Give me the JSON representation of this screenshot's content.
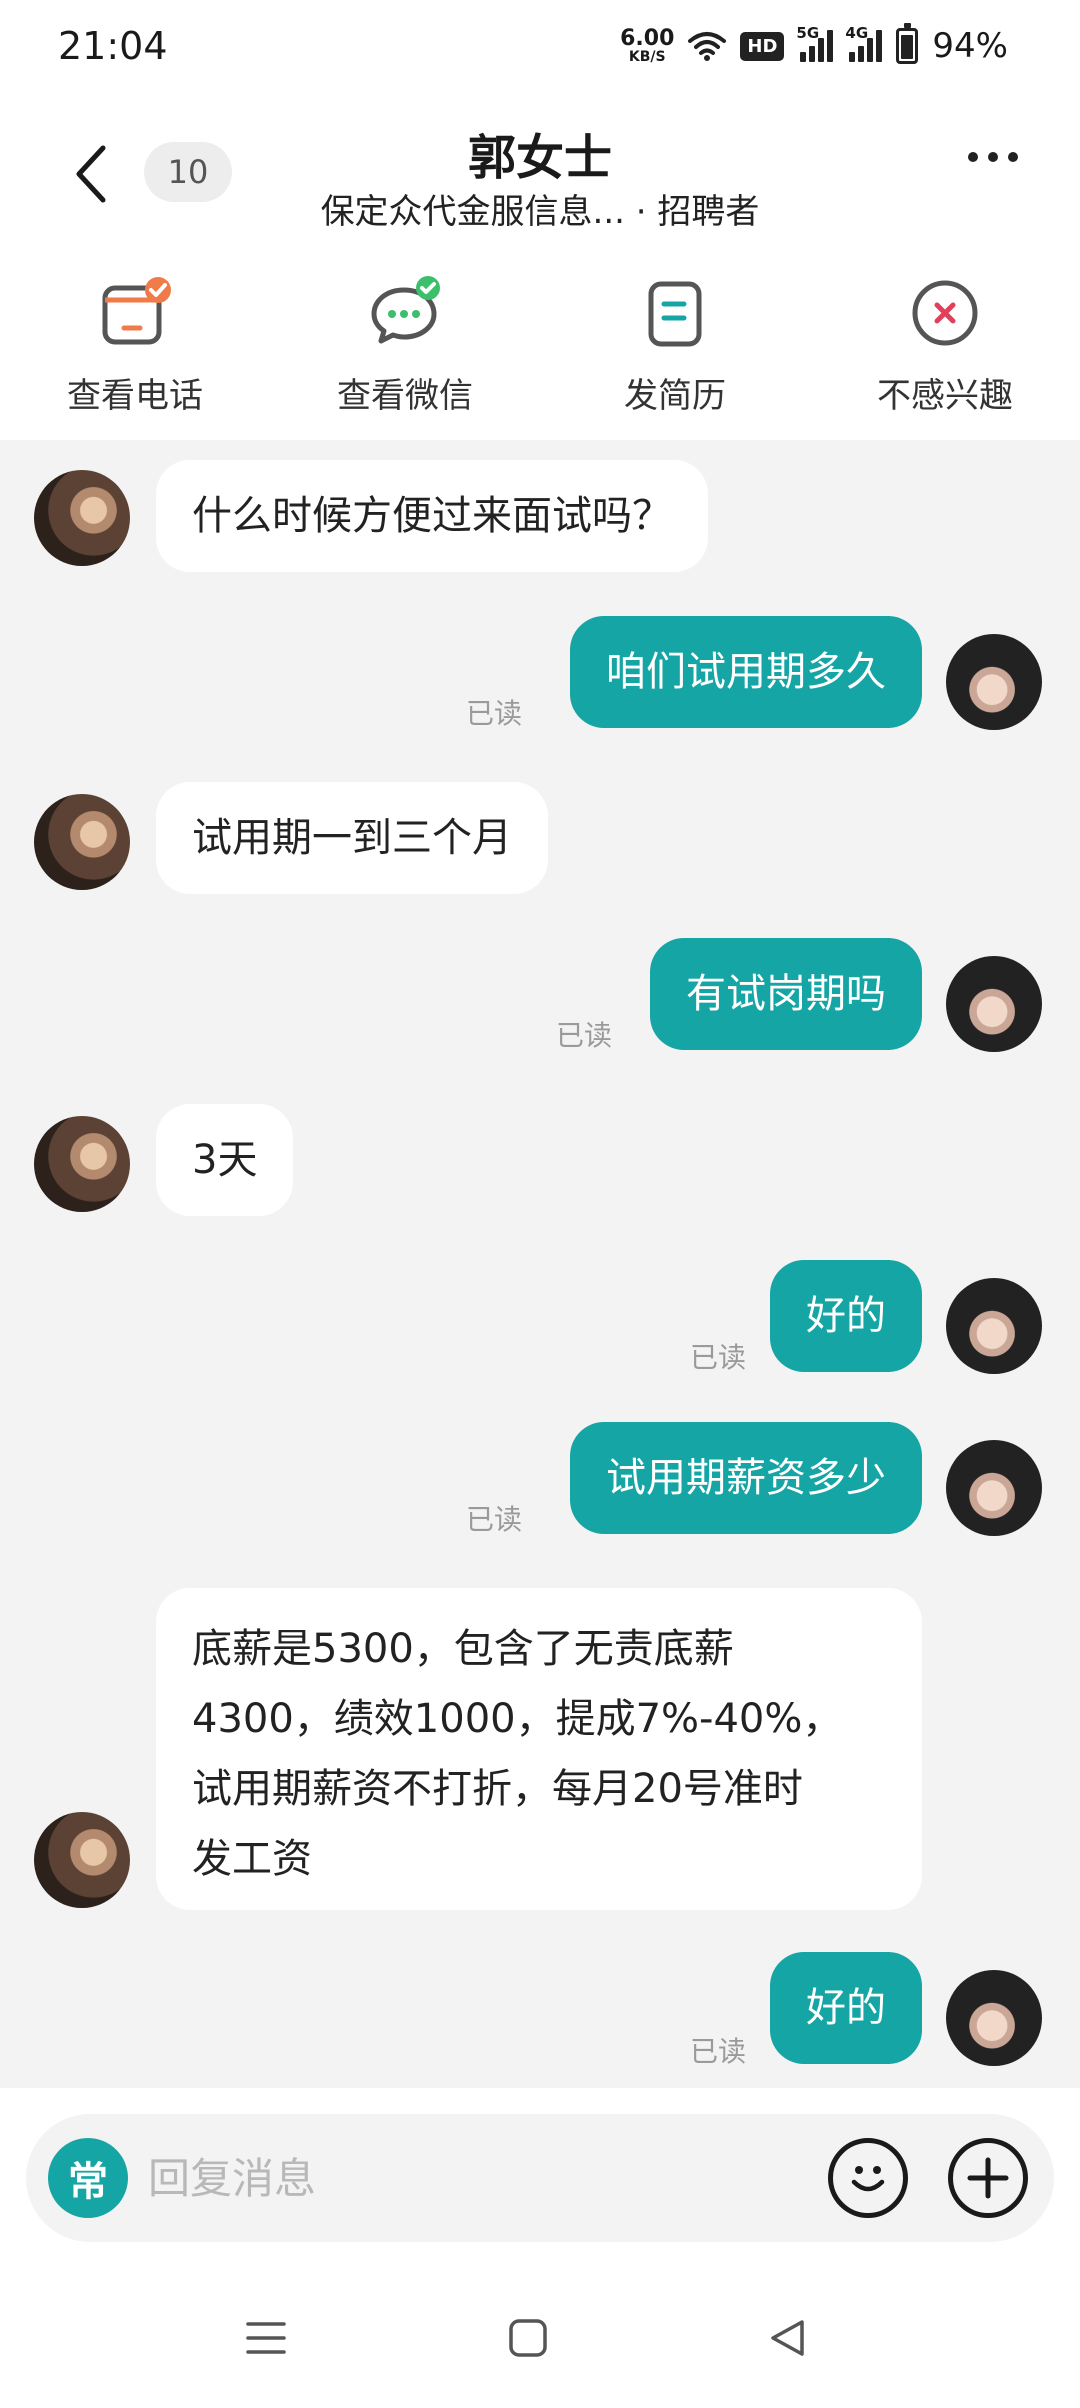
{
  "status_bar": {
    "time": "21:04",
    "net_speed_value": "6.00",
    "net_speed_unit": "KB/S",
    "hd_label": "HD",
    "signal1_label": "5G",
    "signal2_label": "4G",
    "battery_percent": "94%",
    "battery_level": 0.94
  },
  "header": {
    "unread_count": "10",
    "title": "郭女士",
    "subtitle": "保定众代金服信息... · 招聘者"
  },
  "actions": [
    {
      "label": "查看电话",
      "icon": "phone-card-icon",
      "checked": true,
      "check_color": "#f07a4a"
    },
    {
      "label": "查看微信",
      "icon": "wechat-icon",
      "checked": true,
      "check_color": "#3cbf6a"
    },
    {
      "label": "发简历",
      "icon": "resume-icon",
      "checked": false
    },
    {
      "label": "不感兴趣",
      "icon": "not-interested-icon",
      "checked": false
    }
  ],
  "messages": [
    {
      "side": "in",
      "text": "什么时候方便过来面试吗？"
    },
    {
      "side": "out",
      "text": "咱们试用期多久",
      "status": "已读"
    },
    {
      "side": "in",
      "text": "试用期一到三个月"
    },
    {
      "side": "out",
      "text": "有试岗期吗",
      "status": "已读"
    },
    {
      "side": "in",
      "text": "3天"
    },
    {
      "side": "out",
      "text": "好的",
      "status": "已读"
    },
    {
      "side": "out",
      "text": "试用期薪资多少",
      "status": "已读"
    },
    {
      "side": "in",
      "lines": [
        "底薪是5300，包含了无责底薪",
        "4300，绩效1000，提成7%-40%，",
        "试用期薪资不打折，每月20号准时",
        "发工资"
      ]
    },
    {
      "side": "out",
      "text": "好的",
      "status": "已读"
    }
  ],
  "input": {
    "quick_label": "常",
    "placeholder": "回复消息"
  },
  "colors": {
    "accent": "#16a5a5",
    "chat_bg": "#f3f3f3",
    "read_text": "#9a9a9a"
  }
}
